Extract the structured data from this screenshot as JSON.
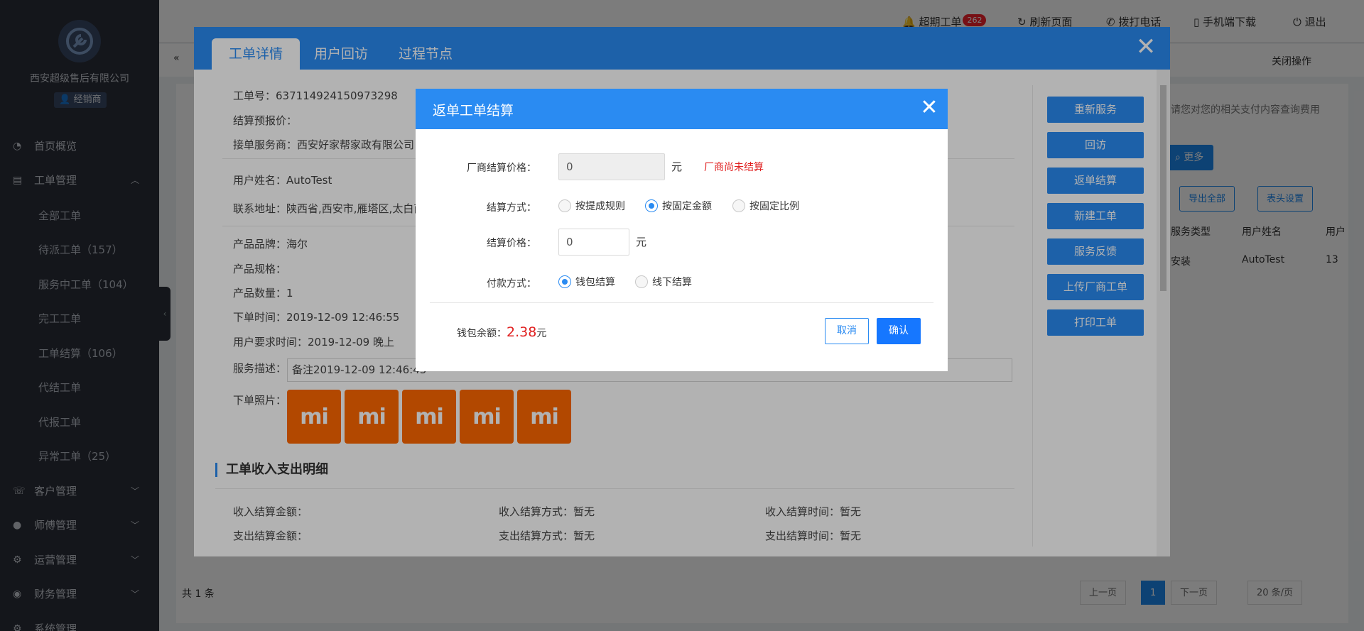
{
  "sidebar": {
    "company": "西安超级售后有限公司",
    "role": "经销商",
    "menu": [
      {
        "icon": "gauge-icon",
        "label": "首页概览"
      },
      {
        "icon": "order-icon",
        "label": "工单管理"
      },
      {
        "icon": "customer-icon",
        "label": "客户管理"
      },
      {
        "icon": "user-icon",
        "label": "师傅管理"
      },
      {
        "icon": "ops-icon",
        "label": "运营管理"
      },
      {
        "icon": "finance-icon",
        "label": "财务管理"
      },
      {
        "icon": "settings-icon",
        "label": "系统管理"
      }
    ],
    "submenu": [
      "全部工单",
      "待派工单（157）",
      "服务中工单（104）",
      "完工工单",
      "工单结算（106）",
      "代结工单",
      "代报工单",
      "异常工单（25）"
    ]
  },
  "topbar": {
    "new_orders": "超期工单",
    "new_orders_badge": "262",
    "refresh": "刷新页面",
    "call": "拨打电话",
    "app_download": "手机端下载",
    "logout": "退出"
  },
  "tabsbar": {
    "ops": "关闭操作"
  },
  "background": {
    "notice": "请您对您的相关支付内容查询费用",
    "more": "更多",
    "export_all": "导出全部",
    "table_settings": "表头设置",
    "col_service_type": "服务类型",
    "col_user_name": "用户姓名",
    "col_phone": "用户",
    "row_service_type": "安装",
    "row_user_name": "AutoTest",
    "row_phone": "13",
    "total": "共 1 条",
    "prev": "上一页",
    "page": "1",
    "next": "下一页",
    "page_size": "20 条/页"
  },
  "detail": {
    "tabs": [
      "工单详情",
      "用户回访",
      "过程节点"
    ],
    "order_no_label": "工单号：",
    "order_no": "637114924150973298",
    "quote_label": "结算预报价：",
    "quote": "",
    "provider_label": "接单服务商：",
    "provider": "西安好家帮家政有限公司",
    "user_label": "用户姓名：",
    "user": "AutoTest",
    "address_label": "联系地址：",
    "address": "陕西省,西安市,雁塔区,太白南",
    "brand_label": "产品品牌：",
    "brand": "海尔",
    "spec_label": "产品规格：",
    "spec": "",
    "qty_label": "产品数量：",
    "qty": "1",
    "order_time_label": "下单时间：",
    "order_time": "2019-12-09 12:46:55",
    "req_time_label": "用户要求时间：",
    "req_time": "2019-12-09 晚上",
    "desc_label": "服务描述：",
    "desc": "备注2019-12-09 12:46:43",
    "photos_label": "下单照片：",
    "photo_text": "mi",
    "section_title": "工单收入支出明细",
    "in_amount_label": "收入结算金额：",
    "in_amount": "",
    "in_method_label": "收入结算方式：",
    "in_method": "暂无",
    "in_time_label": "收入结算时间：",
    "in_time": "暂无",
    "out_amount_label": "支出结算金额：",
    "out_amount": "",
    "out_method_label": "支出结算方式：",
    "out_method": "暂无",
    "out_time_label": "支出结算时间：",
    "out_time": "暂无",
    "actions": [
      "重新服务",
      "回访",
      "返单结算",
      "新建工单",
      "服务反馈",
      "上传厂商工单",
      "打印工单"
    ]
  },
  "modal": {
    "title": "返单工单结算",
    "vendor_price_label": "厂商结算价格：",
    "vendor_price": "0",
    "unit": "元",
    "vendor_warning": "厂商尚未结算",
    "method_label": "结算方式：",
    "methods": [
      "按提成规则",
      "按固定金额",
      "按固定比例"
    ],
    "method_selected": 1,
    "price_label": "结算价格：",
    "price": "0",
    "pay_label": "付款方式：",
    "pay_methods": [
      "钱包结算",
      "线下结算"
    ],
    "pay_selected": 0,
    "balance_label": "钱包余额：",
    "balance": "2.38",
    "balance_unit": "元",
    "cancel": "取消",
    "confirm": "确认"
  }
}
